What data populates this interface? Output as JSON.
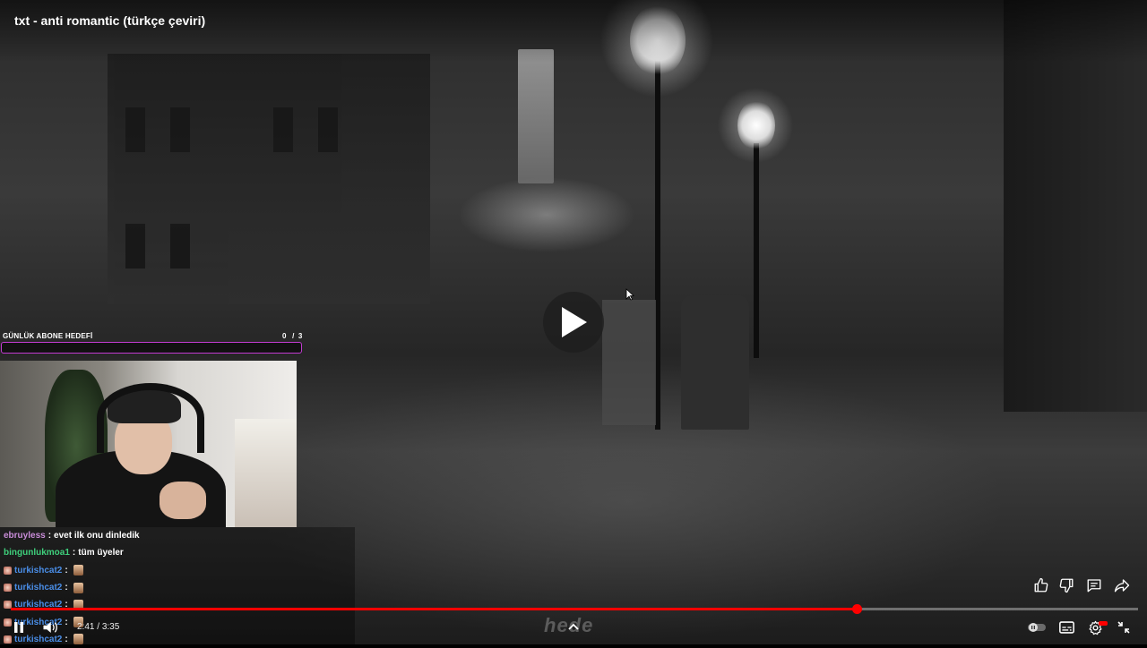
{
  "video": {
    "title": "txt - anti romantic (türkçe çeviri)",
    "time_current": "2:41",
    "time_total": "3:35",
    "progress_fraction": 0.75,
    "watermark": "hede"
  },
  "overlay": {
    "goal_label": "GÜNLÜK ABONE HEDEFİ",
    "goal_current": "0",
    "goal_total": "3",
    "goal_border_color": "#c23bd1"
  },
  "chat": {
    "messages": [
      {
        "user": "ebruyless",
        "color": "#c88cd8",
        "text": "evet ilk onu dinledik",
        "badge": false,
        "emote": false
      },
      {
        "user": "bingunlukmoa1",
        "color": "#3fd07c",
        "text": "tüm üyeler",
        "badge": false,
        "emote": false
      },
      {
        "user": "turkishcat2",
        "color": "#4a8ee8",
        "text": "",
        "badge": true,
        "emote": true
      },
      {
        "user": "turkishcat2",
        "color": "#4a8ee8",
        "text": "",
        "badge": true,
        "emote": true
      },
      {
        "user": "turkishcat2",
        "color": "#4a8ee8",
        "text": "",
        "badge": true,
        "emote": true
      },
      {
        "user": "turkishcat2",
        "color": "#4a8ee8",
        "text": "",
        "badge": true,
        "emote": true
      },
      {
        "user": "turkishcat2",
        "color": "#4a8ee8",
        "text": "",
        "badge": true,
        "emote": true
      }
    ]
  },
  "colors": {
    "progress": "#ff0000",
    "accent": "#ff0000"
  },
  "icons": {
    "center_play": "play-icon",
    "like": "thumbs-up-icon",
    "dislike": "thumbs-down-icon",
    "comments": "comment-icon",
    "share": "share-icon",
    "pause": "pause-icon",
    "volume": "volume-icon",
    "expand": "chevron-up-icon",
    "autoplay": "autoplay-toggle-icon",
    "captions": "captions-icon",
    "settings": "gear-icon",
    "exit_fullscreen": "exit-fullscreen-icon"
  }
}
